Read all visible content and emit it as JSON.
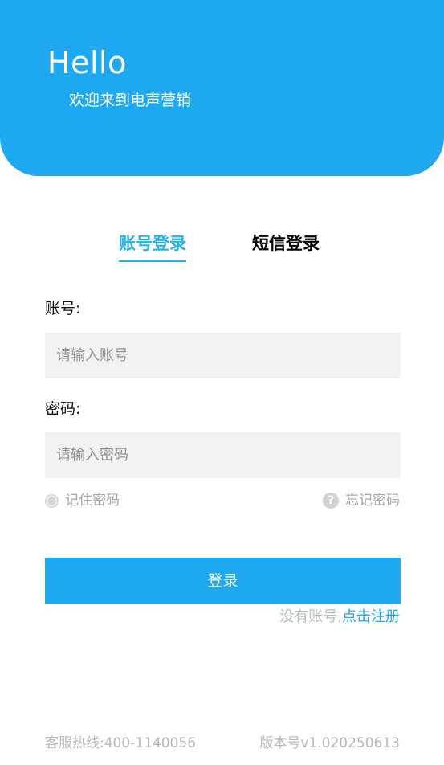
{
  "header": {
    "greeting": "Hello",
    "welcome": "欢迎来到电声营销",
    "background_color": "#1ea8f0"
  },
  "tabs": [
    {
      "label": "账号登录",
      "active": true
    },
    {
      "label": "短信登录",
      "active": false
    }
  ],
  "accent_color": "#28b1ea",
  "form": {
    "account_label": "账号:",
    "account_placeholder": "请输入账号",
    "password_label": "密码:",
    "password_placeholder": "请输入密码",
    "remember_label": "记住密码",
    "remember_icon": "radio-unchecked-icon",
    "forgot_label": "忘记密码",
    "forgot_icon": "question-circle-icon",
    "forgot_icon_glyph": "?"
  },
  "login_button": {
    "label": "登录"
  },
  "register": {
    "prompt": "没有账号,",
    "link": "点击注册"
  },
  "footer": {
    "hotline": "客服热线:400-1140056",
    "version": "版本号v1.020250613"
  }
}
